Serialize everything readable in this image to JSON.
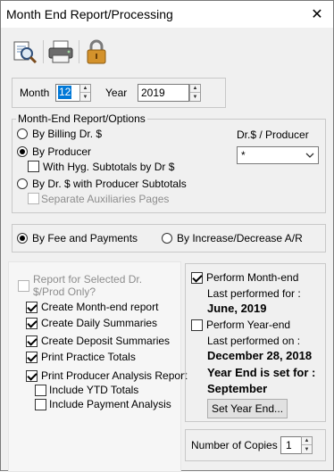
{
  "window": {
    "title": "Month End Report/Processing",
    "close_glyph": "✕"
  },
  "toolbar": {
    "icons": [
      "preview-icon",
      "printer-icon",
      "lock-icon"
    ]
  },
  "period": {
    "month_label": "Month",
    "month_value": "12",
    "year_label": "Year",
    "year_value": "2019"
  },
  "report_options": {
    "legend": "Month-End Report/Options",
    "by_billing": "By Billing Dr. $",
    "by_producer": "By Producer",
    "hyg_subtotals": "With Hyg. Subtotals by Dr $",
    "by_dr_producer": "By Dr. $ with Producer Subtotals",
    "separate_aux": "Separate Auxiliaries Pages",
    "dr_producer_label": "Dr.$ / Producer",
    "dr_producer_value": "*",
    "selected": "By Producer"
  },
  "basis": {
    "fee_payments": "By Fee and Payments",
    "increase_decrease": "By Increase/Decrease A/R",
    "selected": "By Fee and Payments"
  },
  "reports": {
    "selected_only": "Report for Selected Dr. $/Prod Only?",
    "items": [
      {
        "label": "Create Month-end report",
        "checked": true
      },
      {
        "label": "Create Daily Summaries",
        "checked": true
      },
      {
        "label": "Create Deposit Summaries",
        "checked": true
      },
      {
        "label": "Print Practice Totals",
        "checked": true
      },
      {
        "label": "Print Producer Analysis Report",
        "checked": true
      },
      {
        "label": "Include YTD Totals",
        "checked": false
      },
      {
        "label": "Include Payment Analysis",
        "checked": false
      }
    ]
  },
  "processing": {
    "perform_month_end": "Perform Month-end",
    "last_performed_for": "Last performed for :",
    "month_end_date": "June, 2019",
    "perform_year_end": "Perform Year-end",
    "last_performed_on": "Last performed on :",
    "year_end_date": "December 28, 2018",
    "year_end_set_for": "Year End is set for :",
    "year_end_month": "September",
    "set_year_end_button": "Set Year End..."
  },
  "copies": {
    "label": "Number of Copies",
    "value": "1"
  }
}
